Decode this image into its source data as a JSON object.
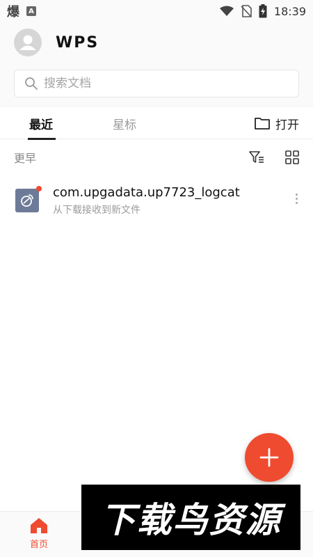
{
  "status_bar": {
    "left_glyph": "爆",
    "a_badge": "A",
    "time": "18:39"
  },
  "header": {
    "logo": "WPS"
  },
  "search": {
    "placeholder": "搜索文档"
  },
  "tabs": [
    {
      "label": "最近",
      "active": true
    },
    {
      "label": "星标",
      "active": false
    }
  ],
  "open_button": {
    "label": "打开"
  },
  "section": {
    "title": "更早"
  },
  "files": [
    {
      "name": "com.upgadata.up7723_logcat",
      "subtitle": "从下载接收到新文件",
      "unread": true
    }
  ],
  "bottom_nav": {
    "home_label": "首页"
  },
  "watermark": {
    "text": "下载鸟资源"
  },
  "colors": {
    "accent": "#ef4b30",
    "file_icon_bg": "#6e7b98",
    "background": "#fafafa"
  },
  "icons": {
    "search": "search-icon",
    "folder": "folder-icon",
    "filter": "filter-icon",
    "grid": "grid-view-icon",
    "more": "more-vertical-icon",
    "add": "plus-icon",
    "home": "home-icon"
  }
}
